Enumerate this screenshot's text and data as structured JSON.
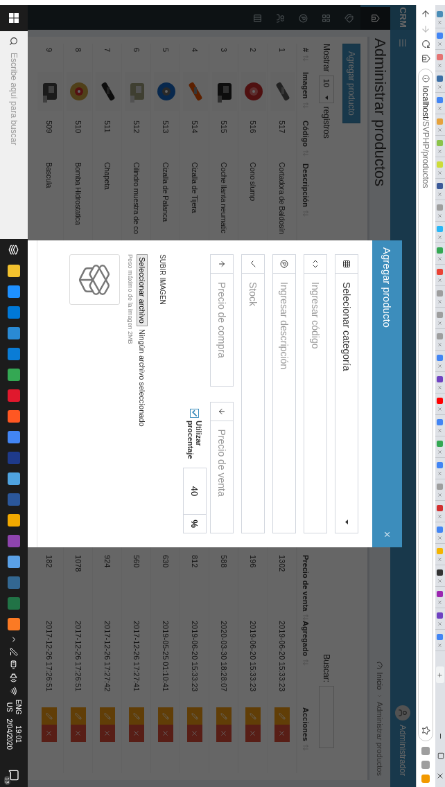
{
  "browser": {
    "tabs": [
      {
        "color": "#4a8db7"
      },
      {
        "color": "#4285f4"
      },
      {
        "color": "#e57373"
      },
      {
        "color": "#3b6ea5"
      },
      {
        "color": "#4285f4"
      },
      {
        "color": "#e6a23c"
      },
      {
        "color": "#8bc34a"
      },
      {
        "color": "#cddc39"
      },
      {
        "color": "#3b5998"
      },
      {
        "color": "#9e9e9e"
      },
      {
        "color": "#29b6f6"
      },
      {
        "color": "#34a853"
      },
      {
        "color": "#ea4335"
      },
      {
        "color": "#9e9e9e"
      },
      {
        "color": "#9e9e9e"
      },
      {
        "color": "#9e9e9e"
      },
      {
        "color": "#4285f4"
      },
      {
        "color": "#6f42c1"
      },
      {
        "color": "#ff0000"
      },
      {
        "color": "#4285f4"
      },
      {
        "color": "#34a853"
      },
      {
        "color": "#4285f4"
      },
      {
        "color": "#9e9e9e"
      },
      {
        "color": "#d32f2f"
      },
      {
        "color": "#4285f4"
      },
      {
        "color": "#f4b400"
      },
      {
        "color": "#333333"
      },
      {
        "color": "#9c27b0"
      },
      {
        "color": "#6f42c1"
      },
      {
        "color": "#4285f4"
      }
    ],
    "address": {
      "host": "localhost",
      "path": "/SVPHP/productos"
    },
    "extensions": [
      {
        "color": "#9e9e9e"
      },
      {
        "color": "#9e9e9e"
      },
      {
        "color": "#f29900"
      }
    ]
  },
  "app": {
    "brand": "CRM",
    "user": "Administrador",
    "sidebar": [
      {
        "selected": true
      },
      {
        "selected": false
      },
      {
        "selected": false
      },
      {
        "selected": false
      },
      {
        "selected": false
      },
      {
        "selected": false
      }
    ],
    "title": "Administrar productos",
    "breadcrumb": [
      "Inicio",
      "Administrar productos"
    ],
    "add_button": "Agregar producto",
    "length": {
      "before": "Mostrar",
      "value": "10",
      "after": "registros"
    },
    "search_label": "Buscar:",
    "columns": [
      "#",
      "Imagen",
      "Código",
      "Descripción",
      "Precio de venta",
      "Agregado",
      "Acciones"
    ],
    "rows": [
      {
        "n": "1",
        "code": "517",
        "description": "Cortadora de Baldosín",
        "price": "1302",
        "added": "2019-06-20 15:33:23"
      },
      {
        "n": "2",
        "code": "516",
        "description": "Cono slump",
        "price": "196",
        "added": "2019-06-20 15:33:23"
      },
      {
        "n": "3",
        "code": "515",
        "description": "Coche llanta neumatic",
        "price": "588",
        "added": "2020-03-30 18:28:07"
      },
      {
        "n": "4",
        "code": "514",
        "description": "Cizalla de Tijera",
        "price": "812",
        "added": "2019-06-20 15:33:23"
      },
      {
        "n": "5",
        "code": "513",
        "description": "Cizalla de Palanca",
        "price": "630",
        "added": "2019-05-25 01:10:41"
      },
      {
        "n": "6",
        "code": "512",
        "description": "Cilindro muestra de co",
        "price": "560",
        "added": "2017-12-26 17:27:41"
      },
      {
        "n": "7",
        "code": "511",
        "description": "Chapeta",
        "price": "924",
        "added": "2017-12-26 17:27:42"
      },
      {
        "n": "8",
        "code": "510",
        "description": "Bomba Hidrostatica",
        "price": "1078",
        "added": "2017-12-26 17:26:51"
      },
      {
        "n": "9",
        "code": "509",
        "description": "Bascula",
        "price": "182",
        "added": "2017-12-26 17:26:51"
      }
    ]
  },
  "modal": {
    "title": "Agregar producto",
    "close": "×",
    "fields": [
      {
        "kind": "select",
        "value": "Selecionar categoría"
      },
      {
        "kind": "input",
        "placeholder": "Ingresar código"
      },
      {
        "kind": "input",
        "placeholder": "Ingresar descripción"
      },
      {
        "kind": "input",
        "placeholder": "Stock"
      }
    ],
    "prices": [
      {
        "placeholder": "Precio de compra"
      },
      {
        "placeholder": "Precio de venta"
      }
    ],
    "percentage": {
      "label": "Utilizar procentaje",
      "checked": true,
      "value": "40",
      "unit": "%"
    },
    "upload": {
      "heading": "SUBIR IMAGEN",
      "button": "Seleccionar archivo",
      "status": "Ningún archivo seleccionado",
      "note": "Peso máximo de la imagen 2MB"
    }
  },
  "taskbar": {
    "search_placeholder": "Escribe aquí para buscar",
    "apps": [
      {
        "color": "#f2c12e"
      },
      {
        "color": "#1e90ff"
      },
      {
        "color": "#0078d7"
      },
      {
        "color": "#2a8ad4"
      },
      {
        "color": "#0a7cd6"
      },
      {
        "color": "#34a853"
      },
      {
        "color": "#e0182d"
      },
      {
        "color": "#ff5722"
      },
      {
        "color": "#4285f4"
      },
      {
        "color": "#1e3a8a"
      },
      {
        "color": "#4fa3e0"
      },
      {
        "color": "#2b579a"
      },
      {
        "color": "#f2a900"
      },
      {
        "color": "#8e44ad"
      },
      {
        "color": "#5aa0e6"
      },
      {
        "color": "#336791"
      },
      {
        "color": "#217346"
      },
      {
        "color": "#fb7a24"
      }
    ],
    "language": "ENG",
    "region": "US",
    "time": "19:01",
    "date": "2/04/2020",
    "notifications": "13"
  }
}
